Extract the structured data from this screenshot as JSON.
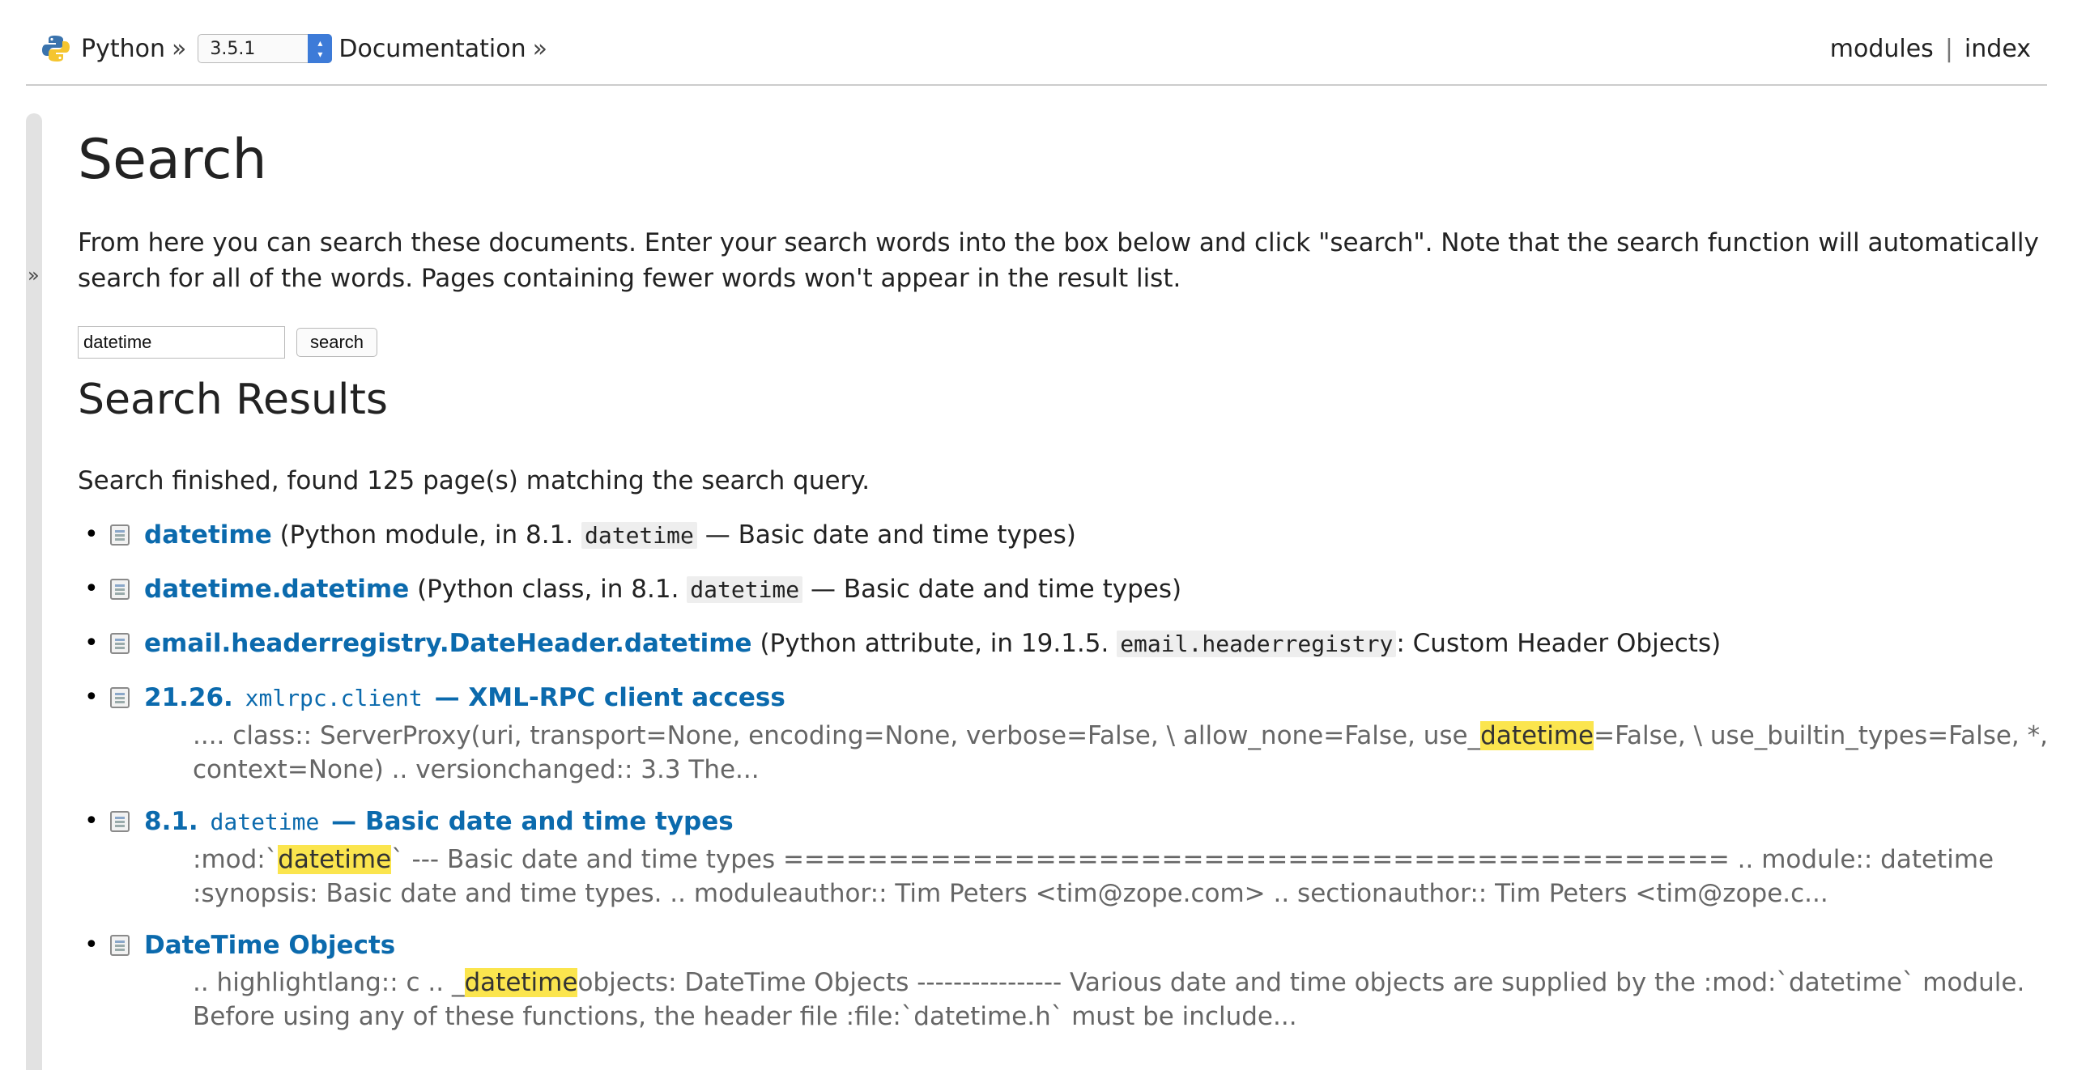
{
  "header": {
    "breadcrumb": {
      "home": "Python",
      "sep1": "»",
      "version": "3.5.1",
      "docs": "Documentation",
      "sep2": "»"
    },
    "links": {
      "modules": "modules",
      "sep": "|",
      "index": "index"
    }
  },
  "sidebar": {
    "toggle": "»"
  },
  "page": {
    "title": "Search",
    "intro": "From here you can search these documents. Enter your search words into the box below and click \"search\". Note that the search function will automatically search for all of the words. Pages containing fewer words won't appear in the result list.",
    "search_value": "datetime",
    "search_button": "search",
    "results_title": "Search Results",
    "status": "Search finished, found 125 page(s) matching the search query."
  },
  "results": [
    {
      "title": "datetime",
      "ctx_pre": " (Python module, in 8.1. ",
      "ctx_code": "datetime",
      "ctx_post": " — Basic date and time types)"
    },
    {
      "title": "datetime.datetime",
      "ctx_pre": " (Python class, in 8.1. ",
      "ctx_code": "datetime",
      "ctx_post": " — Basic date and time types)"
    },
    {
      "title": "email.headerregistry.DateHeader.datetime",
      "ctx_pre": " (Python attribute, in 19.1.5. ",
      "ctx_code": "email.headerregistry",
      "ctx_post": ": Custom Header Objects)"
    },
    {
      "title_pre": "21.26. ",
      "title_code": "xmlrpc.client",
      "title_post": " — XML-RPC client access",
      "excerpt_pre": ".... class:: ServerProxy(uri, transport=None, encoding=None, verbose=False, \\ allow_none=False, use_",
      "excerpt_hl": "datetime",
      "excerpt_post": "=False, \\ use_builtin_types=False, *, context=None) .. versionchanged:: 3.3 The..."
    },
    {
      "title_pre": "8.1. ",
      "title_code": "datetime",
      "title_post": " — Basic date and time types",
      "excerpt_pre": ":mod:`",
      "excerpt_hl": "datetime",
      "excerpt_post": "` --- Basic date and time types ============================================= .. module:: datetime :synopsis: Basic date and time types. .. moduleauthor:: Tim Peters <tim@zope.com> .. sectionauthor:: Tim Peters <tim@zope.c..."
    },
    {
      "title": "DateTime Objects",
      "excerpt_pre": ".. highlightlang:: c .. _",
      "excerpt_hl": "datetime",
      "excerpt_post": "objects: DateTime Objects ---------------- Various date and time objects are supplied by the :mod:`datetime` module. Before using any of these functions, the header file :file:`datetime.h` must be include..."
    }
  ]
}
